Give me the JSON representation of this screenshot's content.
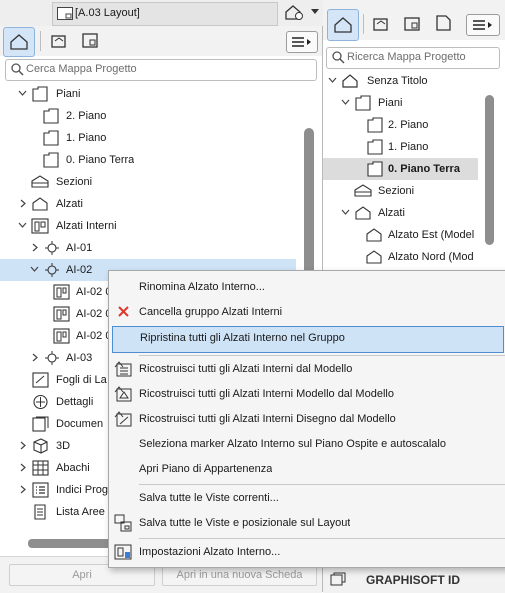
{
  "window": {
    "layout_tab": "[A.03 Layout]"
  },
  "left": {
    "search_placeholder": "Cerca Mappa Progetto",
    "tree": [
      {
        "label": "Piani"
      },
      {
        "label": "2. Piano"
      },
      {
        "label": "1. Piano"
      },
      {
        "label": "0. Piano Terra"
      },
      {
        "label": "Sezioni"
      },
      {
        "label": "Alzati"
      },
      {
        "label": "Alzati Interni"
      },
      {
        "label": "AI-01"
      },
      {
        "label": "AI-02"
      },
      {
        "label": "AI-02 0"
      },
      {
        "label": "AI-02 0"
      },
      {
        "label": "AI-02 0"
      },
      {
        "label": "AI-03"
      },
      {
        "label": "Fogli di La"
      },
      {
        "label": "Dettagli"
      },
      {
        "label": "Documen"
      },
      {
        "label": "3D"
      },
      {
        "label": "Abachi"
      },
      {
        "label": "Indici Prog"
      },
      {
        "label": "Lista Aree"
      }
    ],
    "open_button": "Apri",
    "open_new_tab_button": "Apri in una nuova Scheda"
  },
  "right": {
    "search_placeholder": "Ricerca Mappa Progetto",
    "tree": [
      {
        "label": "Senza Titolo"
      },
      {
        "label": "Piani"
      },
      {
        "label": "2. Piano"
      },
      {
        "label": "1. Piano"
      },
      {
        "label": "0. Piano Terra"
      },
      {
        "label": "Sezioni"
      },
      {
        "label": "Alzati"
      },
      {
        "label": "Alzato Est (Model"
      },
      {
        "label": "Alzato Nord (Mod"
      }
    ],
    "brand": "GRAPHISOFT ID"
  },
  "menu": {
    "items": [
      {
        "label": "Rinomina Alzato Interno..."
      },
      {
        "label": "Cancella gruppo Alzati Interni"
      },
      {
        "label": "Ripristina tutti gli Alzati Interno nel Gruppo"
      },
      {
        "label": "Ricostruisci tutti gli Alzati Interni dal Modello"
      },
      {
        "label": "Ricostruisci tutti gli Alzati Interni Modello dal Modello"
      },
      {
        "label": "Ricostruisci tutti gli Alzati Interni Disegno dal Modello"
      },
      {
        "label": "Seleziona marker Alzato Interno sul Piano Ospite e autoscalalo"
      },
      {
        "label": "Apri Piano di Appartenenza"
      },
      {
        "label": "Salva tutte le Viste correnti..."
      },
      {
        "label": "Salva tutte le Viste e posizionale sul Layout"
      },
      {
        "label": "Impostazioni Alzato Interno..."
      }
    ]
  },
  "colors": {
    "selection": "#cfe3f7",
    "selection_border": "#4f8fd1",
    "delete_icon": "#e0352b",
    "tree_selected": "#cfe3f7",
    "right_selected": "#dcdcdc"
  }
}
